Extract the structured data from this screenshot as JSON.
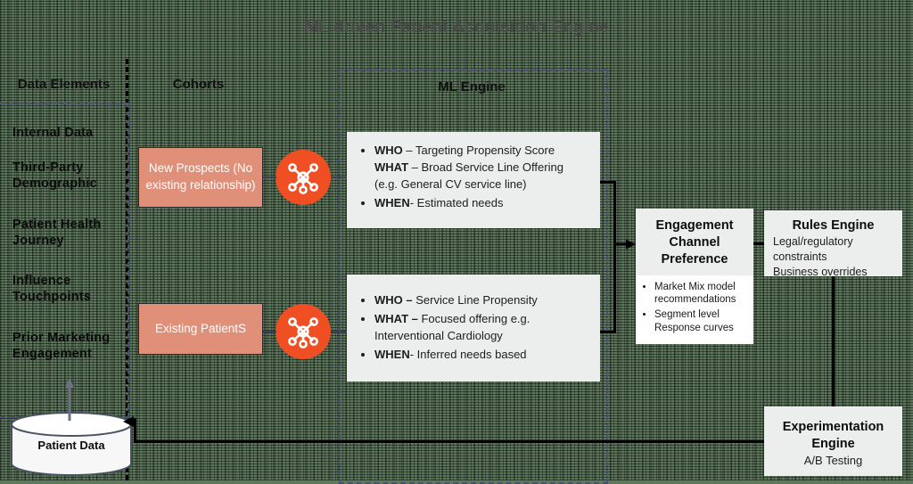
{
  "title": "ML driven Patient Acquisition Engine",
  "columns": {
    "data_elements": "Data Elements",
    "cohorts": "Cohorts",
    "ml_engine": "ML Engine"
  },
  "data_elements": [
    "Internal Data",
    "Third-Party Demographic",
    "Patient Health Journey",
    "Influence Touchpoints",
    "Prior Marketing Engagement"
  ],
  "datastore": {
    "label": "Patient Data",
    "icon": "database-cylinder-icon"
  },
  "cohorts": [
    {
      "label": "New Prospects (No existing relationship)",
      "icon": "network-hub-icon"
    },
    {
      "label": "Existing PatientS",
      "icon": "network-hub-icon"
    }
  ],
  "ml_boxes": [
    {
      "bullets": [
        {
          "strong": "WHO",
          "rest": " – Targeting Propensity Score "
        },
        {
          "strong": "WHAT",
          "rest": " – Broad Service Line Offering (e.g. General CV service line)"
        },
        {
          "strong": "WHEN",
          "rest": "- Estimated needs"
        }
      ]
    },
    {
      "bullets": [
        {
          "strong": "WHO –",
          "rest": " Service Line Propensity"
        },
        {
          "strong": "WHAT –",
          "rest": " Focused offering e.g. Interventional Cardiology"
        },
        {
          "strong": "WHEN",
          "rest": "- Inferred needs based"
        }
      ]
    }
  ],
  "engagement": {
    "title": "Engagement Channel Preference",
    "bullets": [
      "Market Mix model recommendations",
      "Segment level Response curves"
    ]
  },
  "rules_engine": {
    "title": "Rules Engine",
    "lines": [
      "Legal/regulatory constraints",
      "Business overrides"
    ]
  },
  "experimentation": {
    "title": "Experimentation Engine",
    "subtitle": "A/B Testing"
  },
  "colors": {
    "background": "#5d7a5c",
    "cohort_fill": "#e08f78",
    "accent_orange": "#f04e23",
    "box_fill": "#eceded",
    "dash_blue": "#4b4f78",
    "title_text": "#4a4a4a"
  }
}
